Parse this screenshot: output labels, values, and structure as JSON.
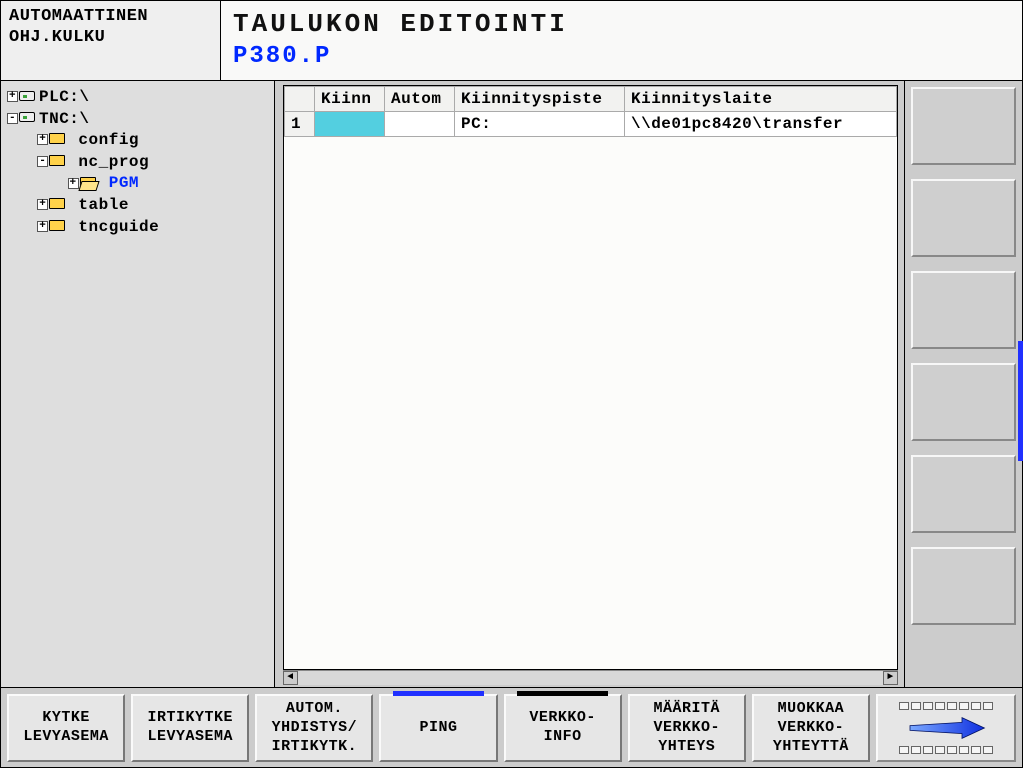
{
  "header": {
    "mode_line1": "AUTOMAATTINEN",
    "mode_line2": "OHJ.KULKU",
    "title_line1": "TAULUKON EDITOINTI",
    "title_line2": "P380.P"
  },
  "tree": {
    "n0": {
      "label": "PLC:\\"
    },
    "n1": {
      "label": "TNC:\\"
    },
    "n2": {
      "label": "config"
    },
    "n3": {
      "label": "nc_prog"
    },
    "n4": {
      "label": "PGM"
    },
    "n5": {
      "label": "table"
    },
    "n6": {
      "label": "tncguide"
    }
  },
  "table": {
    "columns": {
      "rownum": "",
      "c1": "Kiinn",
      "c2": "Autom",
      "c3": "Kiinnityspiste",
      "c4": "Kiinnityslaite"
    },
    "rows": [
      {
        "num": "1",
        "c1": "",
        "c2": "",
        "c3": "PC:",
        "c4": "\\\\de01pc8420\\transfer"
      }
    ]
  },
  "softkeys": {
    "k1": "KYTKE\nLEVYASEMA",
    "k2": "IRTIKYTKE\nLEVYASEMA",
    "k3": "AUTOM.\nYHDISTYS/\nIRTIKYTK.",
    "k4": "PING",
    "k5": "VERKKO-\nINFO",
    "k6": "MÄÄRITÄ\nVERKKO-\nYHTEYS",
    "k7": "MUOKKAA\nVERKKO-\nYHTEYTTÄ"
  }
}
